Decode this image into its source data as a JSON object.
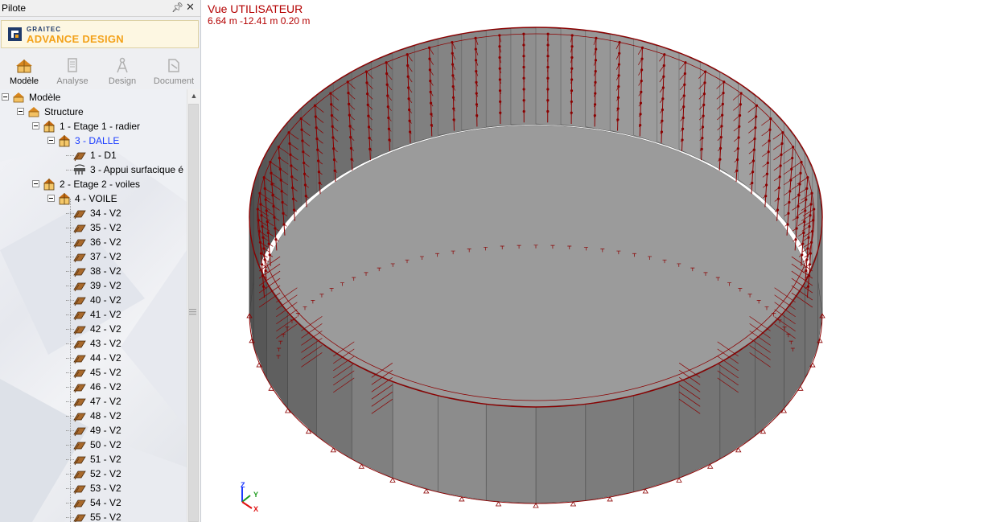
{
  "pilot": {
    "title": "Pilote",
    "pin_icon": "pin-icon",
    "close_icon": "close-icon"
  },
  "brand": {
    "top": "GRAITEC",
    "bottom": "ADVANCE DESIGN",
    "colors": {
      "navy": "#1f3a6a",
      "orange": "#f3a21a"
    }
  },
  "tabs": [
    {
      "label": "Modèle",
      "icon": "model-icon",
      "active": true
    },
    {
      "label": "Analyse",
      "icon": "analysis-icon",
      "active": false
    },
    {
      "label": "Design",
      "icon": "design-compass-icon",
      "active": false
    },
    {
      "label": "Document",
      "icon": "document-icon",
      "active": false
    }
  ],
  "tree": {
    "root": "Modèle",
    "structure": "Structure",
    "level1": "1 - Etage 1 - radier",
    "dalle": "3 - DALLE",
    "d1": "1 - D1",
    "appui": "3 - Appui surfacique é",
    "level2": "2 - Etage 2 - voiles",
    "voile": "4 - VOILE",
    "walls": [
      "34 - V2",
      "35 - V2",
      "36 - V2",
      "37 - V2",
      "38 - V2",
      "39 - V2",
      "40 - V2",
      "41 - V2",
      "42 - V2",
      "43 - V2",
      "44 - V2",
      "45 - V2",
      "46 - V2",
      "47 - V2",
      "48 - V2",
      "49 - V2",
      "50 - V2",
      "51 - V2",
      "52 - V2",
      "53 - V2",
      "54 - V2",
      "55 - V2"
    ]
  },
  "viewport": {
    "title": "Vue UTILISATEUR",
    "coords": "6.64 m  -12.41 m  0.20 m",
    "load_color": "#8b0000",
    "axes": {
      "x": "X",
      "y": "Y",
      "z": "Z"
    }
  }
}
